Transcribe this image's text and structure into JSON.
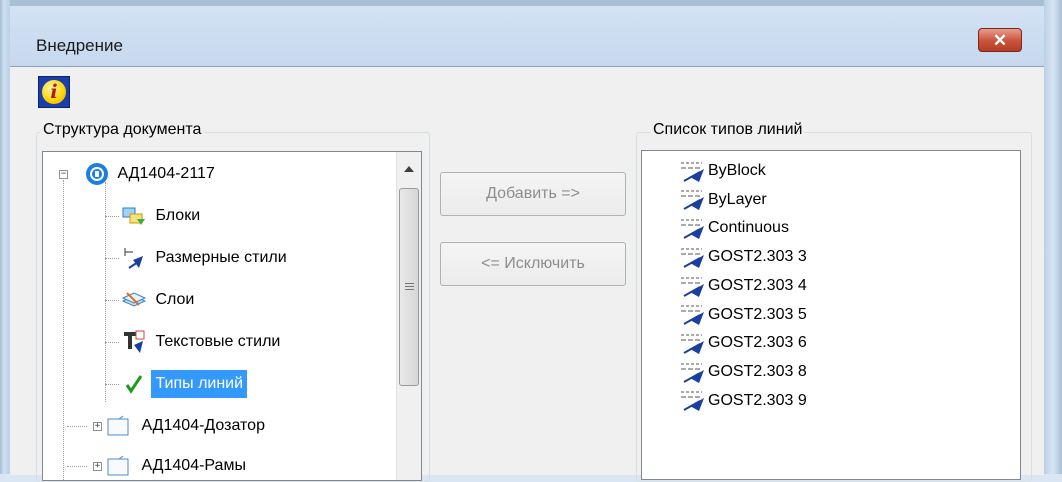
{
  "window": {
    "title": "Внедрение",
    "close_glyph": "✕"
  },
  "info_icon": {
    "glyph": "i"
  },
  "structure": {
    "label": "Структура документа",
    "root": {
      "label": "АД1404-2117",
      "expander": "−"
    },
    "items": [
      {
        "label": "Блоки",
        "icon": "blocks-icon"
      },
      {
        "label": "Размерные стили",
        "icon": "dimension-styles-icon"
      },
      {
        "label": "Слои",
        "icon": "layers-icon"
      },
      {
        "label": "Текстовые стили",
        "icon": "text-styles-icon"
      },
      {
        "label": "Типы линий",
        "icon": "checkmark-icon",
        "selected": true
      }
    ],
    "siblings": [
      {
        "label": "АД1404-Дозатор",
        "expander": "+"
      },
      {
        "label": "АД1404-Рамы",
        "expander": "+"
      }
    ]
  },
  "buttons": {
    "add": "Добавить =>",
    "remove": "<= Исключить"
  },
  "linetypes": {
    "label": "Список типов линий",
    "items": [
      "ByBlock",
      "ByLayer",
      "Continuous",
      "GOST2.303 3",
      "GOST2.303 4",
      "GOST2.303 5",
      "GOST2.303 6",
      "GOST2.303 8",
      "GOST2.303 9"
    ]
  },
  "colors": {
    "selection": "#3399ff",
    "close_button": "#c8523a",
    "disabled_text": "#8d8d8d"
  }
}
